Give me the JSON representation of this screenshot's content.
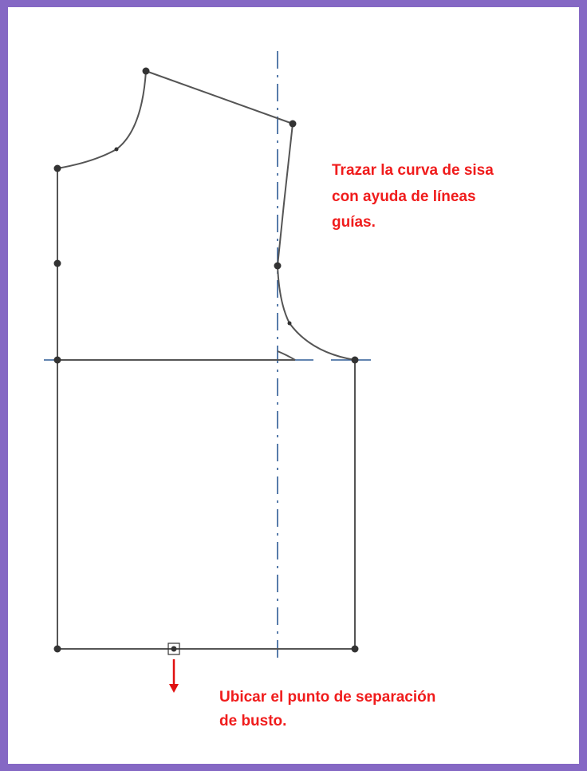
{
  "annotations": {
    "armhole": {
      "line1": "Trazar la curva de sisa",
      "line2": "con ayuda de líneas",
      "line3": "guías."
    },
    "bust": {
      "line1": "Ubicar el punto de separación",
      "line2": "de busto."
    }
  },
  "colors": {
    "border": "#8568c4",
    "pattern_line": "#555555",
    "guide_line": "#2f5b96",
    "annotation_text": "#f01c1c",
    "arrow": "#e01010"
  }
}
